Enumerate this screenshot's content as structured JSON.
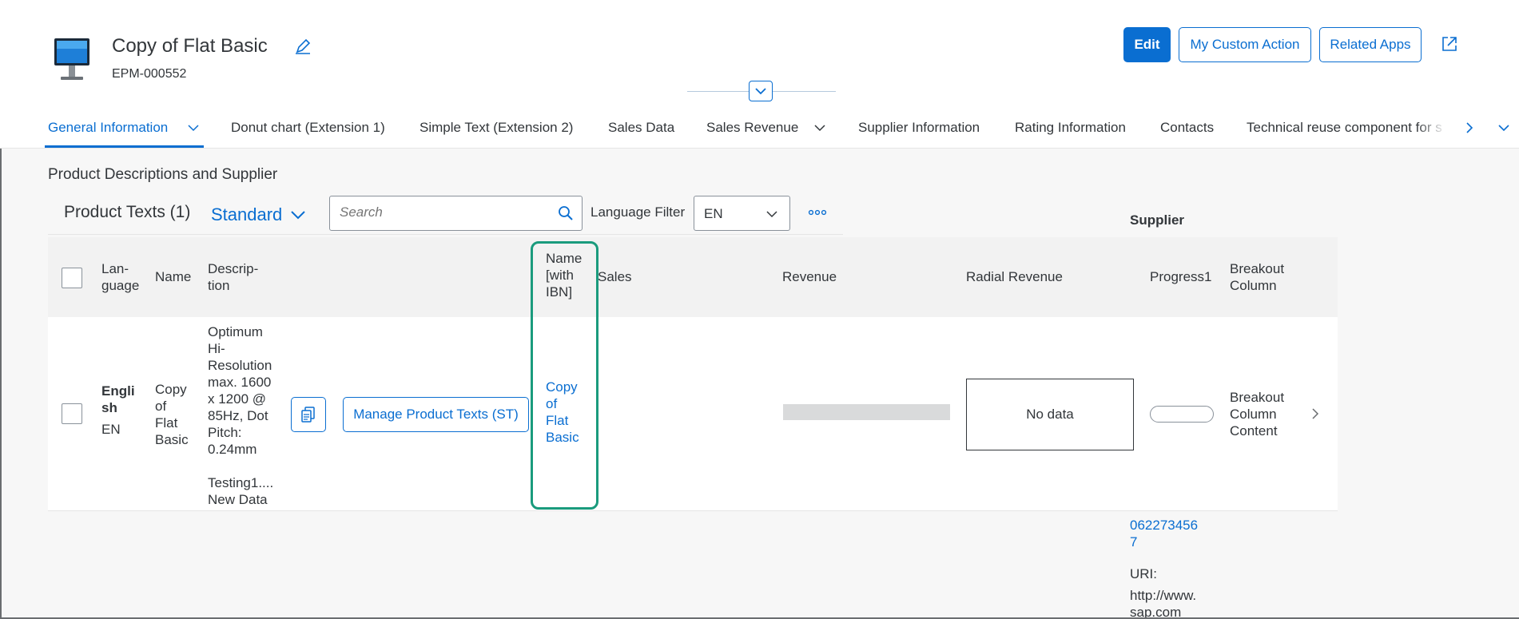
{
  "header": {
    "title": "Copy of Flat Basic",
    "subtitle": "EPM-000552",
    "actions": {
      "edit": "Edit",
      "custom": "My Custom Action",
      "related": "Related Apps"
    }
  },
  "tabs": [
    {
      "label": "General Information",
      "has_menu": true
    },
    {
      "label": "Donut chart (Extension 1)"
    },
    {
      "label": "Simple Text (Extension 2)"
    },
    {
      "label": "Sales Data"
    },
    {
      "label": "Sales Revenue",
      "has_menu": true
    },
    {
      "label": "Supplier Information"
    },
    {
      "label": "Rating Information"
    },
    {
      "label": "Contacts"
    },
    {
      "label": "Technical reuse component for s"
    }
  ],
  "section": {
    "title": "Product Descriptions and Supplier",
    "table_title": "Product Texts (1)",
    "variant": "Standard",
    "search_placeholder": "Search",
    "language_filter_label": "Language Filter",
    "language_value": "EN",
    "supplier_label": "Supplier"
  },
  "columns": {
    "language": [
      "Lan-",
      "guage"
    ],
    "name": "Name",
    "description": [
      "Descrip-",
      "tion"
    ],
    "name_ibn": [
      "Name",
      "[with",
      "IBN]"
    ],
    "sales": "Sales",
    "revenue": "Revenue",
    "radial": "Radial Revenue",
    "progress": "Progress1",
    "breakout": [
      "Breakout",
      "Column"
    ]
  },
  "row": {
    "language": [
      "Engli",
      "sh"
    ],
    "language_code": "EN",
    "name": [
      "Copy",
      "of",
      "Flat",
      "Basic"
    ],
    "description": [
      "Optimum",
      "Hi-",
      "Resolution",
      "max. 1600",
      "x 1200 @",
      "85Hz, Dot",
      "Pitch:",
      "0.24mm"
    ],
    "description2": [
      "Testing1....",
      "New Data"
    ],
    "manage_button": "Manage Product Texts (ST)",
    "name_ibn": [
      "Copy",
      "of",
      "Flat",
      "Basic"
    ],
    "radial": "No data",
    "breakout": [
      "Breakout",
      "Column",
      "Content"
    ]
  },
  "supplier": {
    "phone": [
      "062273456",
      "7"
    ],
    "uri_label": "URI:",
    "uri": [
      "http://www.",
      "sap.com"
    ]
  },
  "colors": {
    "accent": "#0a6ed1",
    "highlight": "#1a9b7d",
    "text": "#32363a"
  }
}
